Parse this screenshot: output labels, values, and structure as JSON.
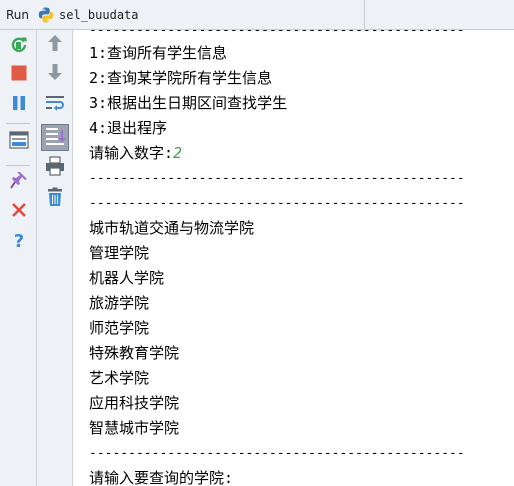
{
  "titlebar": {
    "run_label": "Run",
    "config_name": "sel_buudata"
  },
  "icons": {
    "python": "python-logo-icon",
    "rerun": "rerun-icon",
    "stop": "stop-icon",
    "pause": "pause-icon",
    "layout": "restore-layout-icon",
    "pin": "pin-icon",
    "close": "close-icon",
    "help": "help-icon",
    "up": "arrow-up-icon",
    "down": "arrow-down-icon",
    "soft_wrap": "soft-wrap-icon",
    "scroll_end": "scroll-to-end-icon",
    "print": "print-icon",
    "trash": "trash-icon"
  },
  "colors": {
    "user_input": "#43a047",
    "stop_red": "#e05a46",
    "pause_blue": "#3c8ad8",
    "rerun_green": "#3aa657"
  },
  "console": {
    "top_dash": "------------------------------------------------",
    "menu": [
      "1:查询所有学生信息",
      "2:查询某学院所有学生信息",
      "3:根据出生日期区间查找学生",
      "4:退出程序"
    ],
    "prompt_number": "请输入数字:",
    "input_number": "2",
    "dash": "------------------------------------------------",
    "colleges": [
      "城市轨道交通与物流学院",
      "管理学院",
      "机器人学院",
      "旅游学院",
      "师范学院",
      "特殊教育学院",
      "艺术学院",
      "应用科技学院",
      "智慧城市学院"
    ],
    "prompt_college": "请输入要查询的学院:"
  }
}
